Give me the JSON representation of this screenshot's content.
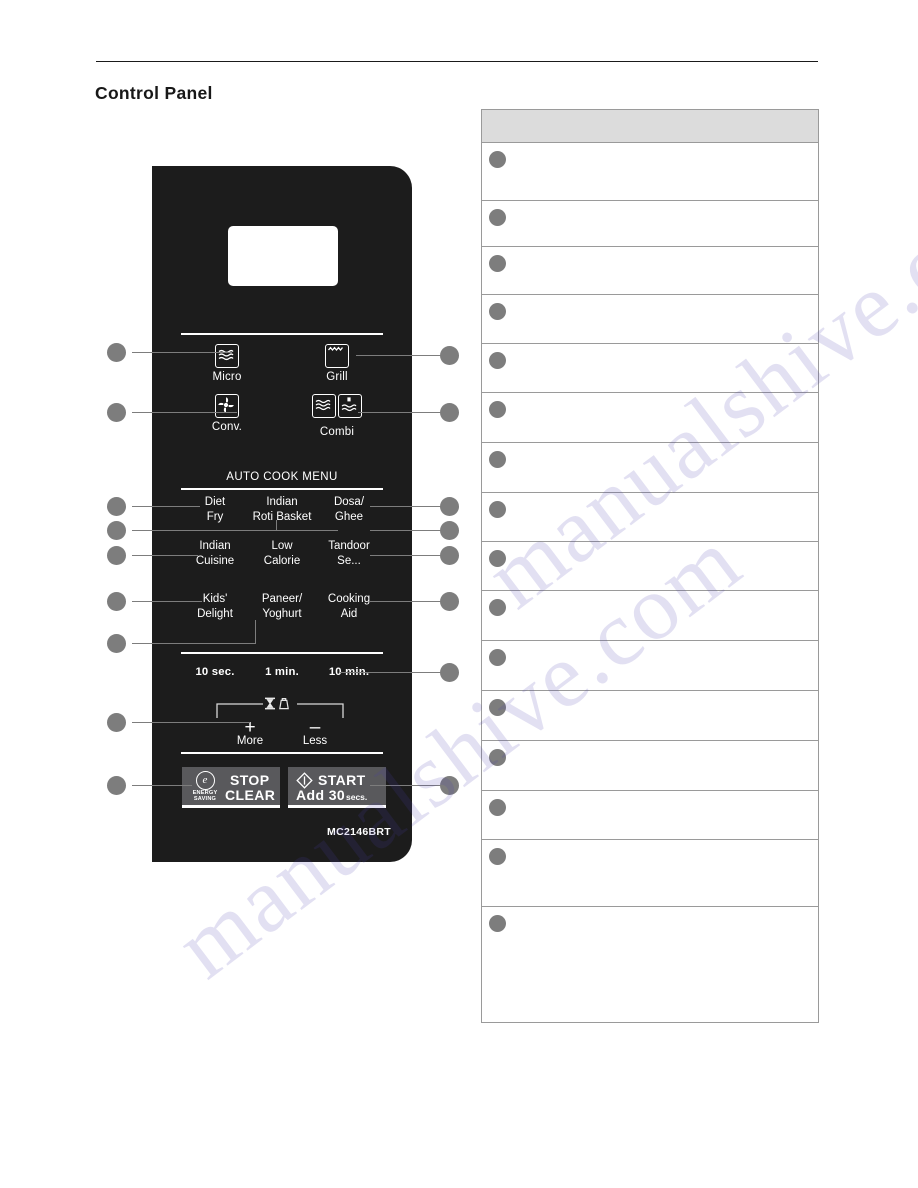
{
  "page": {
    "title": "Control Panel",
    "model_number": "MC2146BRT",
    "watermark": "manualshive.com"
  },
  "panel": {
    "display_value": "",
    "mode_buttons": [
      {
        "label": "Micro",
        "icon": "microwave-waves-icon"
      },
      {
        "label": "Grill",
        "icon": "grill-element-icon"
      },
      {
        "label": "Conv.",
        "icon": "convection-fan-icon"
      },
      {
        "label": "Combi",
        "icon": "combi-micro-grill-icon"
      }
    ],
    "auto_cook_title": "AUTO COOK MENU",
    "auto_cook_buttons": [
      {
        "line1": "Diet",
        "line2": "Fry"
      },
      {
        "line1": "Indian",
        "line2": "Roti Basket"
      },
      {
        "line1": "Dosa/",
        "line2": "Ghee"
      },
      {
        "line1": "Indian",
        "line2": "Cuisine"
      },
      {
        "line1": "Low",
        "line2": "Calorie"
      },
      {
        "line1": "Tandoor",
        "line2": "Se..."
      },
      {
        "line1": "Kids'",
        "line2": "Delight"
      },
      {
        "line1": "Paneer/",
        "line2": "Yoghurt"
      },
      {
        "line1": "Cooking",
        "line2": "Aid"
      }
    ],
    "time_buttons": [
      "10 sec.",
      "1 min.",
      "10 min."
    ],
    "adjust": {
      "more_label": "More",
      "less_label": "Less",
      "plus_glyph": "+",
      "minus_glyph": "–",
      "timer_icon": "hourglass-icon",
      "weight_icon": "weight-icon"
    },
    "action_buttons": [
      {
        "main": "STOP",
        "sub": "CLEAR",
        "badge_letter": "e",
        "badge_line1": "ENERGY",
        "badge_line2": "SAVING",
        "icon": "energy-saving-icon"
      },
      {
        "main": "START",
        "sub": "Add 30",
        "sub_small": "secs.",
        "icon": "start-diamond-icon"
      }
    ]
  },
  "description_table": {
    "header": "",
    "rows": [
      {
        "text": ""
      },
      {
        "text": ""
      },
      {
        "text": ""
      },
      {
        "text": ""
      },
      {
        "text": ""
      },
      {
        "text": ""
      },
      {
        "text": ""
      },
      {
        "text": ""
      },
      {
        "text": ""
      },
      {
        "text": ""
      },
      {
        "text": ""
      },
      {
        "text": ""
      },
      {
        "text": ""
      },
      {
        "text": ""
      },
      {
        "text": ""
      },
      {
        "text": ""
      }
    ]
  },
  "colors": {
    "panel_bg": "#1c1c1c",
    "callout_dot": "#7d7d7d",
    "table_header_bg": "#dcdcdc",
    "table_border": "#9a9a9a",
    "action_button_bg": "#59595c"
  }
}
